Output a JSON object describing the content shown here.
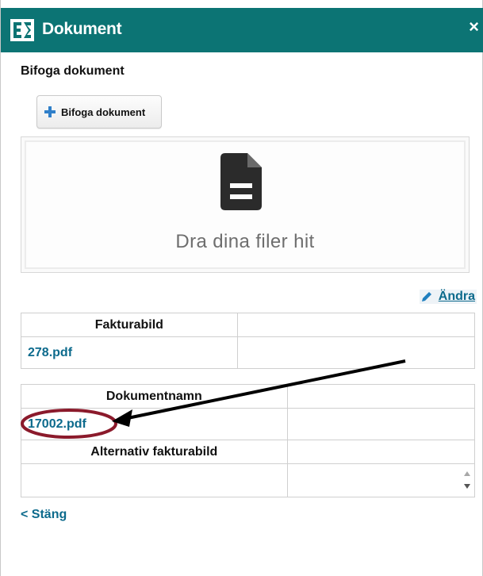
{
  "dialog": {
    "title": "Dokument",
    "close_glyph": "×",
    "logo_icon": "company-logo-icon",
    "title_bar_color": "#0c7474"
  },
  "attach": {
    "section_label": "Bifoga dokument",
    "button_label": "Bifoga dokument",
    "button_icon": "plus-icon"
  },
  "dropzone": {
    "text": "Dra dina filer hit",
    "icon": "file-document-icon"
  },
  "edit": {
    "label": "Ändra",
    "icon": "pencil-icon"
  },
  "invoice_table": {
    "header": "Fakturabild",
    "file": "278.pdf"
  },
  "document_table": {
    "header": "Dokumentnamn",
    "file": "17002.pdf",
    "alt_header": "Alternativ fakturabild"
  },
  "footer": {
    "close_label": "< Stäng"
  },
  "colors": {
    "accent": "#0c7474",
    "link": "#0c6a8c",
    "annotation_circle": "#8b1a2b",
    "annotation_arrow": "#000000"
  }
}
